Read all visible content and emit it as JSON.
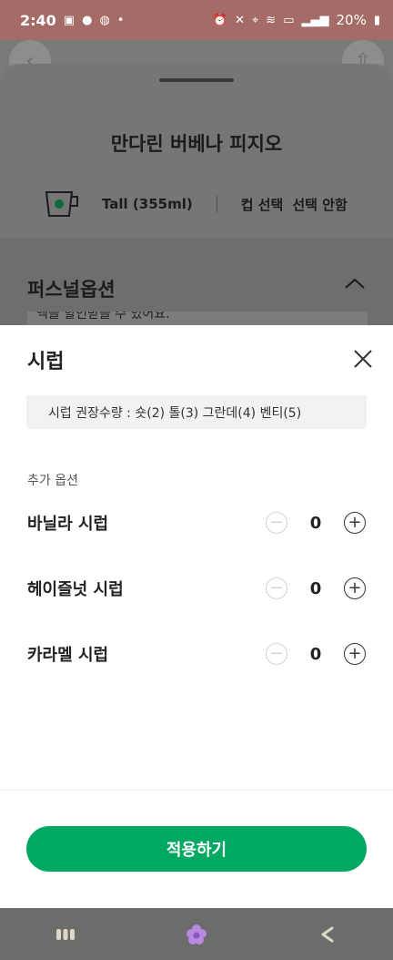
{
  "status_bar": {
    "time": "2:40",
    "battery": "20%",
    "left_icons": [
      "image-icon",
      "talk-icon",
      "lock-icon",
      "dot-icon"
    ],
    "right_icons": [
      "alarm-icon",
      "mute-icon",
      "location-icon",
      "wifi-icon",
      "hd-icon",
      "signal-icon",
      "battery-icon"
    ]
  },
  "product": {
    "name": "만다린 버베나 피지오",
    "size": "Tall (355ml)",
    "cup_label": "컵 선택",
    "cup_value": "선택 안함"
  },
  "personal_options": {
    "title": "퍼스널옵션",
    "cut_text": "액을 할인받을 수 있어요."
  },
  "syrup_sheet": {
    "title": "시럽",
    "recommendation": "시럽 권장수량 : 숏(2) 톨(3) 그란데(4) 벤티(5)",
    "extra_label": "추가 옵션",
    "items": [
      {
        "name": "바닐라 시럽",
        "qty": "0"
      },
      {
        "name": "헤이즐넛 시럽",
        "qty": "0"
      },
      {
        "name": "카라멜 시럽",
        "qty": "0"
      }
    ],
    "apply_label": "적용하기"
  },
  "colors": {
    "accent_green": "#00a862",
    "status_bar": "#a56b66"
  }
}
